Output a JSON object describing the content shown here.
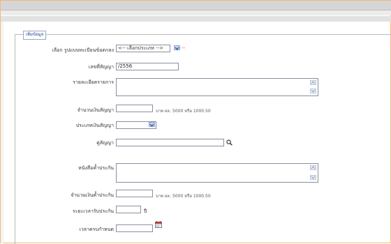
{
  "legend": "เพิ่มข้อมูล",
  "form": {
    "register_type": {
      "label": "เลือก รูปแบบทะเบียนข้อตกลง",
      "value": "<-- เลือกประเภท -->",
      "required_mark": "--"
    },
    "contract_no": {
      "label": "เลขที่สัญญา",
      "value": "/2556"
    },
    "details": {
      "label": "รายละเอียดรายการ",
      "value": ""
    },
    "contract_amount": {
      "label": "จำนวนเงินสัญญา",
      "value": "",
      "hint": "บาท ex. 5000 หรือ 1000.50"
    },
    "contract_type": {
      "label": "ประเภทเงินสัญญา",
      "value": ""
    },
    "party": {
      "label": "คู่สัญญา",
      "value": ""
    },
    "guarantee_doc": {
      "label": "หนังสือค้ำประกัน",
      "value": ""
    },
    "guarantee_amount": {
      "label": "จำนวนเงินค้ำประกัน",
      "value": "",
      "hint": "บาท ex. 5000 หรือ 1000.50"
    },
    "guarantee_period": {
      "label": "ระยะเวลารับประกัน",
      "value": "",
      "unit": "ปี"
    },
    "due_date": {
      "label": "เวลาครบกำหนด",
      "value": ""
    }
  },
  "icons": {
    "search": "search-icon",
    "calendar": "calendar-icon",
    "dropdown": "chevron-down-icon"
  }
}
